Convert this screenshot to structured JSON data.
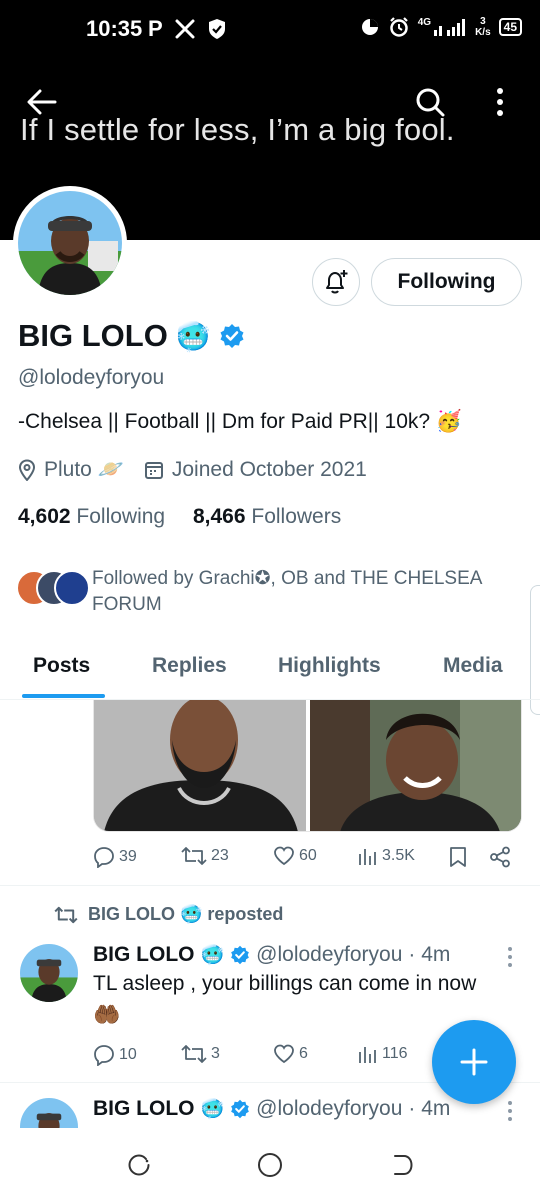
{
  "status_bar": {
    "time": "10:35",
    "network": "4G",
    "speed_value": "3",
    "speed_unit": "K/s",
    "battery": "45",
    "icons": [
      "p-app-icon",
      "x-app-icon",
      "shield-icon",
      "data-saver-icon",
      "alarm-icon",
      "signal-icon",
      "battery-icon"
    ]
  },
  "banner": {
    "text": "If I settle for less, I’m a big fool."
  },
  "profile": {
    "name": "BIG LOLO",
    "handle": "@lolodeyforyou",
    "bio": "-Chelsea || Football || Dm for Paid PR|| 10k? 🥳",
    "location": "Pluto 🪐",
    "joined": "Joined October 2021",
    "following_count": "4,602",
    "following_label": "Following",
    "followers_count": "8,466",
    "followers_label": "Followers",
    "follow_button": "Following",
    "followed_by": "Followed by Grachi✪, OB and THE CHELSEA FORUM",
    "verified_color": "#1d9bf0"
  },
  "tabs": [
    {
      "label": "Posts",
      "active": true
    },
    {
      "label": "Replies",
      "active": false
    },
    {
      "label": "Highlights",
      "active": false
    },
    {
      "label": "Media",
      "active": false
    }
  ],
  "feed": {
    "post1": {
      "replies": "39",
      "reposts": "23",
      "likes": "60",
      "views": "3.5K"
    },
    "post2": {
      "repost_label": "BIG LOLO 🥶 reposted",
      "author_name": "BIG LOLO",
      "author_handle": "@lolodeyforyou",
      "time": "· 4m",
      "text": "TL asleep , your billings can come in now",
      "emoji": "🤲🏾",
      "replies": "10",
      "reposts": "3",
      "likes": "6",
      "views": "116"
    },
    "post3": {
      "author_name": "BIG LOLO",
      "author_handle": "@lolodeyforyou",
      "time": "· 4m"
    }
  },
  "colors": {
    "accent": "#1d9bf0",
    "text_primary": "#0f1419",
    "text_secondary": "#536471"
  }
}
